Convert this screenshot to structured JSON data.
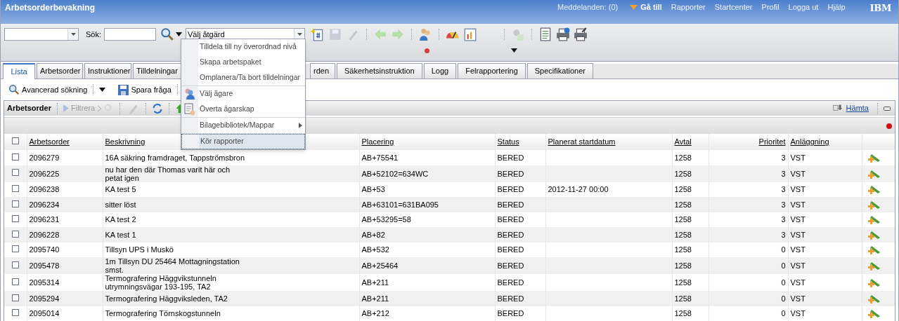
{
  "header": {
    "title": "Arbetsorderbevakning",
    "messages": "Meddelanden: (0)",
    "goto": "Gå till",
    "links": [
      "Rapporter",
      "Startcenter",
      "Profil",
      "Logga ut",
      "Hjälp"
    ],
    "logo": "IBM"
  },
  "toolbar": {
    "search_label": "Sök:",
    "action_select": "Välj åtgärd"
  },
  "action_menu": [
    [
      {
        "label": "Tilldela till ny överordnad nivå",
        "kind": "plain",
        "selected": false
      },
      {
        "label": "Skapa arbetspaket",
        "kind": "plain",
        "selected": false
      },
      {
        "label": "Omplanera/Ta bort tilldelningar",
        "kind": "plain",
        "selected": false
      }
    ],
    [
      {
        "label": "Välj ägare",
        "kind": "owner",
        "selected": false
      },
      {
        "label": "Överta ägarskap",
        "kind": "transfer",
        "selected": false
      }
    ],
    [
      {
        "label": "Bilagebibliotek/Mappar",
        "kind": "submenu",
        "selected": false
      }
    ],
    [
      {
        "label": "Kör rapporter",
        "kind": "plain",
        "selected": true
      }
    ]
  ],
  "tabs": [
    {
      "label": "Lista",
      "selected": true
    },
    {
      "label": "Arbetsorder",
      "selected": false
    },
    {
      "label": "Instruktioner",
      "selected": false
    },
    {
      "label": "Tilldelningar",
      "selected": false
    },
    {
      "label": "rden",
      "selected": false
    },
    {
      "label": "Säkerhetsinstruktion",
      "selected": false
    },
    {
      "label": "Logg",
      "selected": false
    },
    {
      "label": "Felrapportering",
      "selected": false
    },
    {
      "label": "Specifikationer",
      "selected": false
    }
  ],
  "query_bar": {
    "advanced_search": "Avancerad sökning",
    "save_query": "Spara fråga"
  },
  "table": {
    "title": "Arbetsorder",
    "filter": "Filtrera",
    "download": "Hämta",
    "header_checked": false,
    "columns": [
      "Arbetsorder",
      "Beskrivning",
      "Placering",
      "Status",
      "Planerat startdatum",
      "Avtal",
      "Prioritet",
      "Anläggning"
    ],
    "rows": [
      {
        "checked": false,
        "cells": [
          "2096279",
          "16A säkring framdraget, Tappströmsbron",
          "AB+75541",
          "BERED",
          "",
          "1258",
          "3",
          "VST"
        ]
      },
      {
        "checked": false,
        "cells": [
          "2096225",
          "nu har den där Thomas varit här och petat igen",
          "AB+52102=634WC",
          "BERED",
          "",
          "1258",
          "3",
          "VST"
        ]
      },
      {
        "checked": false,
        "cells": [
          "2096238",
          "KA test 5",
          "AB+53",
          "BERED",
          "2012-11-27 00:00",
          "1258",
          "3",
          "VST"
        ]
      },
      {
        "checked": false,
        "cells": [
          "2096234",
          "sitter löst",
          "AB+63101=631BA095",
          "BERED",
          "",
          "1258",
          "3",
          "VST"
        ]
      },
      {
        "checked": false,
        "cells": [
          "2096231",
          "KA test 2",
          "AB+53295=58",
          "BERED",
          "",
          "1258",
          "3",
          "VST"
        ]
      },
      {
        "checked": false,
        "cells": [
          "2096228",
          "KA test 1",
          "AB+82",
          "BERED",
          "",
          "1258",
          "3",
          "VST"
        ]
      },
      {
        "checked": false,
        "cells": [
          "2095740",
          "Tillsyn UPS i Muskö",
          "AB+532",
          "BERED",
          "",
          "1258",
          "0",
          "VST"
        ]
      },
      {
        "checked": false,
        "cells": [
          "2095478",
          "1m Tillsyn DU 25464 Mottagningstation smst.",
          "AB+25464",
          "BERED",
          "",
          "1258",
          "0",
          "VST"
        ]
      },
      {
        "checked": false,
        "cells": [
          "2095314",
          "Termografering Häggvikstunneln utrymningsvägar 193-195, TA2",
          "AB+211",
          "BERED",
          "",
          "1258",
          "0",
          "VST"
        ]
      },
      {
        "checked": false,
        "cells": [
          "2095294",
          "Termografering Häggviksleden, TA2",
          "AB+211",
          "BERED",
          "",
          "1258",
          "0",
          "VST"
        ]
      },
      {
        "checked": false,
        "cells": [
          "2095014",
          "Termografering Törnskogstunneln",
          "AB+212",
          "BERED",
          "",
          "1258",
          "0",
          "VST"
        ]
      }
    ]
  }
}
